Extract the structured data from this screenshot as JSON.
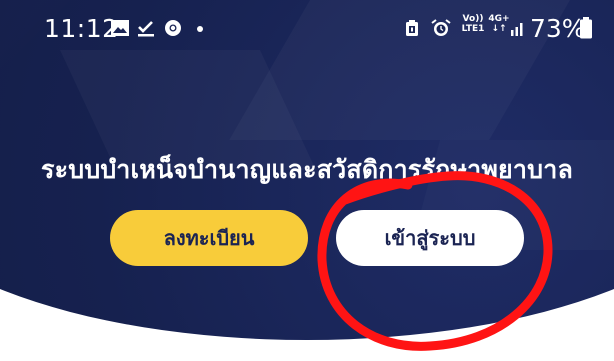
{
  "status_bar": {
    "time": "11:12",
    "left_icons": [
      "image-icon",
      "download-done-icon",
      "chrome-icon",
      "dot-icon"
    ],
    "right_icons": [
      "battery-saver-icon",
      "alarm-icon",
      "volte-icon",
      "4g-icon",
      "signal-icon",
      "battery-icon"
    ],
    "volte_top": "Vo))",
    "volte_bottom": "LTE1",
    "net_top": "4G+",
    "net_bottom": "↓↑",
    "battery_percent": "73%"
  },
  "hero": {
    "title": "ระบบบำเหน็จบำนาญและสวัสดิการรักษาพยาบาล"
  },
  "buttons": {
    "register_label": "ลงทะเบียน",
    "login_label": "เข้าสู่ระบบ"
  },
  "colors": {
    "hero_navy": "#16214f",
    "register_yellow": "#f8cc3a",
    "login_white": "#ffffff",
    "annotation_red": "#ff1414"
  }
}
